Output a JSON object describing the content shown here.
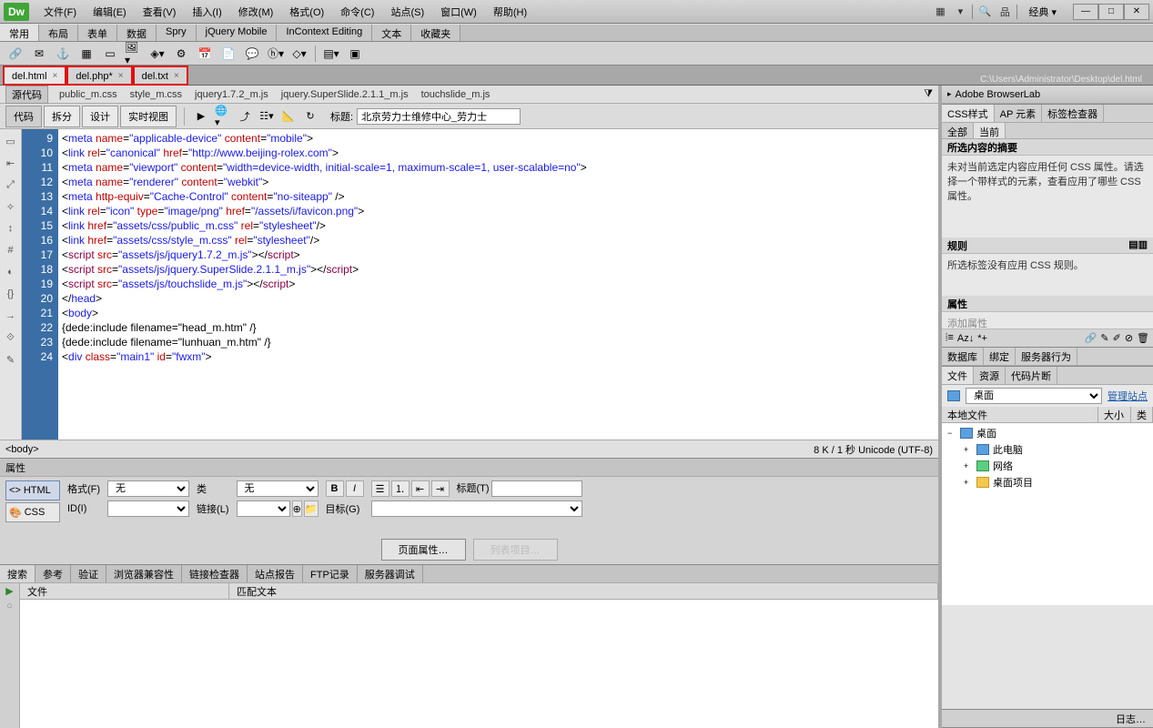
{
  "titlebar": {
    "logo": "Dw",
    "menus": [
      "文件(F)",
      "编辑(E)",
      "查看(V)",
      "插入(I)",
      "修改(M)",
      "格式(O)",
      "命令(C)",
      "站点(S)",
      "窗口(W)",
      "帮助(H)"
    ],
    "workspace": "经典",
    "win_min": "—",
    "win_max": "□",
    "win_close": "✕"
  },
  "insert_tabs": [
    "常用",
    "布局",
    "表单",
    "数据",
    "Spry",
    "jQuery Mobile",
    "InContext Editing",
    "文本",
    "收藏夹"
  ],
  "file_tabs": [
    {
      "label": "del.html",
      "active": true,
      "boxed": true
    },
    {
      "label": "del.php*",
      "active": false,
      "boxed": true
    },
    {
      "label": "del.txt",
      "active": false,
      "boxed": true
    }
  ],
  "file_path": "C:\\Users\\Administrator\\Desktop\\del.html",
  "related": {
    "src": "源代码",
    "files": [
      "public_m.css",
      "style_m.css",
      "jquery1.7.2_m.js",
      "jquery.SuperSlide.2.1.1_m.js",
      "touchslide_m.js"
    ]
  },
  "doc_tb": {
    "views": [
      "代码",
      "拆分",
      "设计",
      "实时视图"
    ],
    "title_label": "标题:",
    "title_value": "北京劳力士维修中心_劳力士"
  },
  "code_lines": [
    {
      "n": 9,
      "html": "<span class='t-txt'>&lt;</span><span class='t-tag'>meta</span> <span class='t-attr'>name</span>=<span class='t-val'>\"applicable-device\"</span> <span class='t-attr'>content</span>=<span class='t-val'>\"mobile\"</span><span class='t-txt'>&gt;</span>"
    },
    {
      "n": 10,
      "html": "<span class='t-txt'>&lt;</span><span class='t-tag'>link</span> <span class='t-attr'>rel</span>=<span class='t-val'>\"canonical\"</span> <span class='t-attr'>href</span>=<span class='t-val'>\"http://www.beijing-rolex.com\"</span><span class='t-txt'>&gt;</span>"
    },
    {
      "n": 11,
      "html": "<span class='t-txt'>&lt;</span><span class='t-tag'>meta</span> <span class='t-attr'>name</span>=<span class='t-val'>\"viewport\"</span> <span class='t-attr'>content</span>=<span class='t-val'>\"width=device-width, initial-scale=1, maximum-scale=1, user-scalable=no\"</span><span class='t-txt'>&gt;</span>"
    },
    {
      "n": 12,
      "html": "<span class='t-txt'>&lt;</span><span class='t-tag'>meta</span> <span class='t-attr'>name</span>=<span class='t-val'>\"renderer\"</span> <span class='t-attr'>content</span>=<span class='t-val'>\"webkit\"</span><span class='t-txt'>&gt;</span>"
    },
    {
      "n": 13,
      "html": "<span class='t-txt'>&lt;</span><span class='t-tag'>meta</span> <span class='t-attr'>http-equiv</span>=<span class='t-val'>\"Cache-Control\"</span> <span class='t-attr'>content</span>=<span class='t-val'>\"no-siteapp\"</span> <span class='t-txt'>/&gt;</span>"
    },
    {
      "n": 14,
      "html": "<span class='t-txt'>&lt;</span><span class='t-tag'>link</span> <span class='t-attr'>rel</span>=<span class='t-val'>\"icon\"</span> <span class='t-attr'>type</span>=<span class='t-val'>\"image/png\"</span> <span class='t-attr'>href</span>=<span class='t-val'>\"/assets/i/favicon.png\"</span><span class='t-txt'>&gt;</span>"
    },
    {
      "n": 15,
      "html": "<span class='t-txt'>&lt;</span><span class='t-tag'>link</span> <span class='t-attr'>href</span>=<span class='t-val'>\"assets/css/public_m.css\"</span> <span class='t-attr'>rel</span>=<span class='t-val'>\"stylesheet\"</span><span class='t-txt'>/&gt;</span>"
    },
    {
      "n": 16,
      "html": "<span class='t-txt'>&lt;</span><span class='t-tag'>link</span> <span class='t-attr'>href</span>=<span class='t-val'>\"assets/css/style_m.css\"</span> <span class='t-attr'>rel</span>=<span class='t-val'>\"stylesheet\"</span><span class='t-txt'>/&gt;</span>"
    },
    {
      "n": 17,
      "html": "<span class='t-txt'>&lt;</span><span class='t-scr'>script</span> <span class='t-attr'>src</span>=<span class='t-val'>\"assets/js/jquery1.7.2_m.js\"</span><span class='t-txt'>&gt;&lt;/</span><span class='t-scr'>script</span><span class='t-txt'>&gt;</span>"
    },
    {
      "n": 18,
      "html": "<span class='t-txt'>&lt;</span><span class='t-scr'>script</span> <span class='t-attr'>src</span>=<span class='t-val'>\"assets/js/jquery.SuperSlide.2.1.1_m.js\"</span><span class='t-txt'>&gt;&lt;/</span><span class='t-scr'>script</span><span class='t-txt'>&gt;</span>"
    },
    {
      "n": 19,
      "html": "<span class='t-txt'>&lt;</span><span class='t-scr'>script</span> <span class='t-attr'>src</span>=<span class='t-val'>\"assets/js/touchslide_m.js\"</span><span class='t-txt'>&gt;&lt;/</span><span class='t-scr'>script</span><span class='t-txt'>&gt;</span>"
    },
    {
      "n": 20,
      "html": "<span class='t-txt'>&lt;/</span><span class='t-tag'>head</span><span class='t-txt'>&gt;</span>"
    },
    {
      "n": 21,
      "html": "<span class='t-txt'>&lt;</span><span class='t-tag'>body</span><span class='t-txt'>&gt;</span>"
    },
    {
      "n": 22,
      "html": "<span class='t-txt'>{dede:include filename=\"head_m.htm\" /}</span>"
    },
    {
      "n": 23,
      "html": "<span class='t-txt'>{dede:include filename=\"lunhuan_m.htm\" /}</span>"
    },
    {
      "n": 24,
      "html": "<span class='t-txt'>&lt;</span><span class='t-tag'>div</span> <span class='t-attr'>class</span>=<span class='t-val'>\"main1\"</span> <span class='t-attr'>id</span>=<span class='t-val'>\"fwxm\"</span><span class='t-txt'>&gt;</span>"
    }
  ],
  "status": {
    "tag": "<body>",
    "right": "8 K / 1 秒 Unicode (UTF-8)"
  },
  "props": {
    "title": "属性",
    "html_btn": "HTML",
    "css_btn": "CSS",
    "format_lbl": "格式(F)",
    "format_val": "无",
    "class_lbl": "类",
    "class_val": "无",
    "id_lbl": "ID(I)",
    "link_lbl": "链接(L)",
    "title2_lbl": "标题(T)",
    "target_lbl": "目标(G)",
    "page_btn": "页面属性…",
    "list_btn": "列表项目…"
  },
  "search": {
    "tabs": [
      "搜索",
      "参考",
      "验证",
      "浏览器兼容性",
      "链接检查器",
      "站点报告",
      "FTP记录",
      "服务器调试"
    ],
    "col_file": "文件",
    "col_match": "匹配文本"
  },
  "rp_browserlab": "Adobe BrowserLab",
  "rp_css": {
    "tabs": [
      "CSS样式",
      "AP 元素",
      "标签检查器"
    ],
    "sub_tabs": [
      "全部",
      "当前"
    ],
    "summary_head": "所选内容的摘要",
    "summary_body": "未对当前选定内容应用任何 CSS 属性。请选择一个带样式的元素，查看应用了哪些 CSS 属性。",
    "rules_head": "规则",
    "rules_body": "所选标签没有应用 CSS 规则。",
    "props_head": "属性",
    "props_add": "添加属性"
  },
  "rp_db_tabs": [
    "数据库",
    "绑定",
    "服务器行为"
  ],
  "rp_files": {
    "tabs": [
      "文件",
      "资源",
      "代码片断"
    ],
    "site_sel": "桌面",
    "manage": "管理站点",
    "cols": [
      "本地文件",
      "大小",
      "类"
    ],
    "tree": [
      {
        "icon": "disk",
        "label": "桌面",
        "indent": 0,
        "exp": "−"
      },
      {
        "icon": "disk",
        "label": "此电脑",
        "indent": 1,
        "exp": "+"
      },
      {
        "icon": "net",
        "label": "网络",
        "indent": 1,
        "exp": "+"
      },
      {
        "icon": "folder",
        "label": "桌面项目",
        "indent": 1,
        "exp": "+"
      }
    ]
  },
  "log_label": "日志…"
}
